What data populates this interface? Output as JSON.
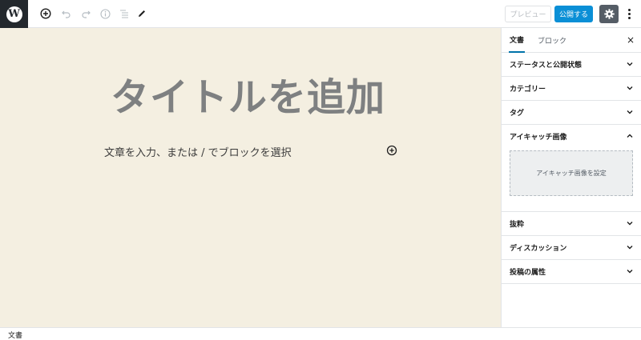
{
  "toolbar": {
    "logo_letter": "W",
    "preview_label": "プレビュー",
    "publish_label": "公開する",
    "icons": [
      "add-block-icon",
      "undo-icon",
      "redo-icon",
      "info-icon",
      "list-view-icon",
      "edit-icon",
      "gear-icon",
      "more-vertical-icon"
    ]
  },
  "editor": {
    "title_placeholder": "タイトルを追加",
    "block_placeholder": "文章を入力、または / でブロックを選択"
  },
  "sidebar": {
    "tabs": [
      {
        "label": "文書",
        "active": true
      },
      {
        "label": "ブロック",
        "active": false
      }
    ],
    "close_symbol": "×",
    "panels": [
      {
        "label": "ステータスと公開状態",
        "expanded": false
      },
      {
        "label": "カテゴリー",
        "expanded": false
      },
      {
        "label": "タグ",
        "expanded": false
      },
      {
        "label": "アイキャッチ画像",
        "expanded": true,
        "button_label": "アイキャッチ画像を設定"
      },
      {
        "label": "抜粋",
        "expanded": false
      },
      {
        "label": "ディスカッション",
        "expanded": false
      },
      {
        "label": "投稿の属性",
        "expanded": false
      }
    ]
  },
  "footer": {
    "breadcrumb": "文書"
  },
  "colors": {
    "canvas_bg": "#f4efe1",
    "publish_bg": "#0a8fd6",
    "logo_bg": "#23282d",
    "settings_bg": "#555d66"
  }
}
